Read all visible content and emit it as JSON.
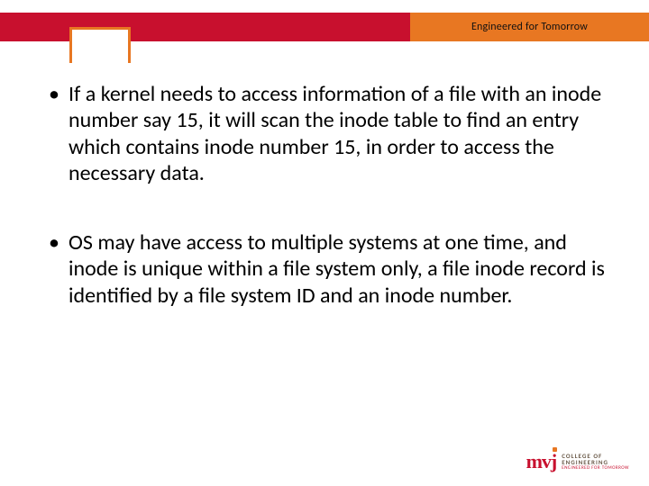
{
  "header": {
    "tagline": "Engineered for Tomorrow"
  },
  "bullets": [
    "If a kernel needs to access information of a file with an inode number say 15, it will scan the inode table to find an entry which contains inode number 15, in order to access the necessary data.",
    "OS may have access to multiple systems at one time, and inode is unique within a file system only, a file inode record is identified by a file system ID and an inode number."
  ],
  "logo": {
    "mark": "mvj",
    "line1": "COLLEGE OF",
    "line2": "ENGINEERING",
    "line3": "ENGINEERED FOR TOMORROW"
  }
}
